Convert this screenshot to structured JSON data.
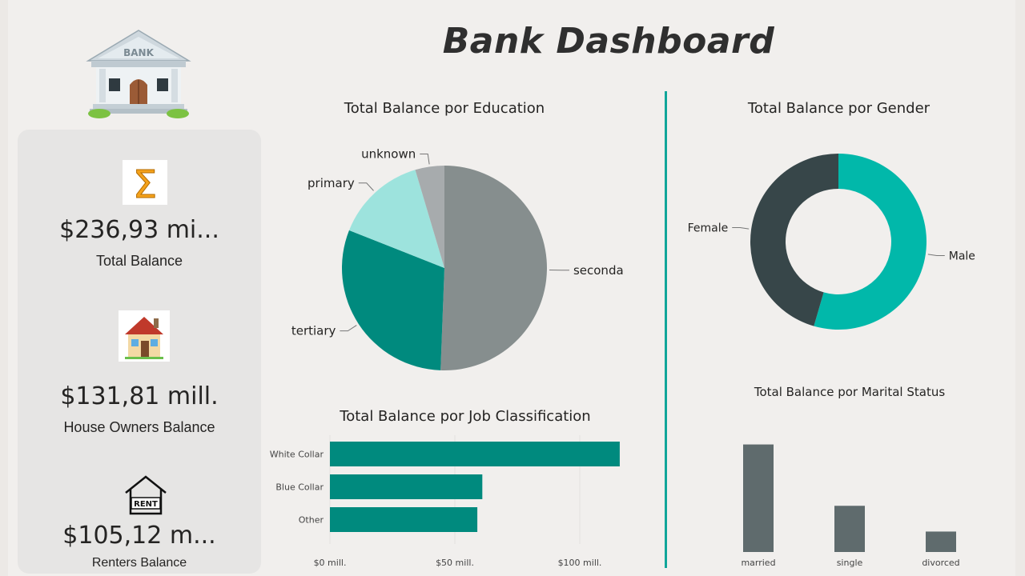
{
  "header": {
    "title": "Bank Dashboard",
    "logo_text": "BANK"
  },
  "kpis": [
    {
      "value": "$236,93 mi...",
      "label": "Total Balance",
      "icon": "sigma-icon"
    },
    {
      "value": "$131,81 mill.",
      "label": "House Owners Balance",
      "icon": "house-icon"
    },
    {
      "value": "$105,12 m...",
      "label": "Renters Balance",
      "icon": "rent-house-icon",
      "icon_text": "RENT"
    }
  ],
  "colors": {
    "teal_dark": "#008a7e",
    "teal": "#01b8aa",
    "teal_light": "#9de3dd",
    "gray": "#868e8e",
    "gray_light": "#a7abad",
    "charcoal": "#374649",
    "bar_gray": "#5f6b6d"
  },
  "chart_data": [
    {
      "type": "pie",
      "title": "Total Balance por Education",
      "categories": [
        "secondary",
        "tertiary",
        "primary",
        "unknown"
      ],
      "values": [
        50.6,
        30.4,
        14.4,
        4.6
      ],
      "colors": [
        "#868e8e",
        "#008a7e",
        "#9de3dd",
        "#a7abad"
      ]
    },
    {
      "type": "pie",
      "variant": "donut",
      "title": "Total Balance por Gender",
      "categories": [
        "Male",
        "Female"
      ],
      "values": [
        54.5,
        45.5
      ],
      "colors": [
        "#01b8aa",
        "#374649"
      ]
    },
    {
      "type": "bar",
      "orientation": "horizontal",
      "title": "Total Balance por Job Classification",
      "categories": [
        "White Collar",
        "Blue Collar",
        "Other"
      ],
      "values": [
        116,
        61,
        59
      ],
      "xlim": [
        0,
        125
      ],
      "xticks": [
        0,
        50,
        100
      ],
      "xtick_labels": [
        "$0 mill.",
        "$50 mill.",
        "$100 mill."
      ],
      "grid": true,
      "color": "#008a7e"
    },
    {
      "type": "bar",
      "title": "Total Balance por Marital Status",
      "categories": [
        "married",
        "single",
        "divorced"
      ],
      "values": [
        142,
        61,
        27
      ],
      "ylim": [
        0,
        150
      ],
      "color": "#5f6b6d"
    }
  ]
}
